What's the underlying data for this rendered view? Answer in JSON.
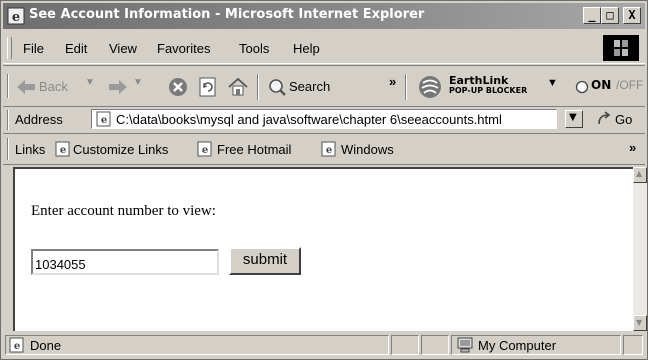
{
  "window": {
    "title": "See Account Information - Microsoft Internet Explorer",
    "controls": {
      "minimize": "_",
      "maximize": "□",
      "close": "X"
    }
  },
  "menu": [
    "File",
    "Edit",
    "View",
    "Favorites",
    "Tools",
    "Help"
  ],
  "toolbar": {
    "back_label": "Back",
    "search_label": "Search",
    "more_glyph": "»",
    "earthlink_top": "EarthLink",
    "earthlink_bottom": "POP-UP BLOCKER",
    "on_label": "ON",
    "off_label": "/OFF"
  },
  "address": {
    "label": "Address",
    "url": "C:\\data\\books\\mysql and java\\software\\chapter 6\\seeaccounts.html",
    "go_label": "Go"
  },
  "links": {
    "label": "Links",
    "items": [
      "Customize Links",
      "Free Hotmail",
      "Windows"
    ],
    "more_glyph": "»"
  },
  "page": {
    "prompt": "Enter account number to view:",
    "account_value": "1034055",
    "submit_label": "submit"
  },
  "status": {
    "text": "Done",
    "zone": "My Computer"
  },
  "colors": {
    "chrome": "#d4d0c8",
    "title_gradient_start": "#6e6e6e",
    "content_bg": "#ffffff"
  }
}
